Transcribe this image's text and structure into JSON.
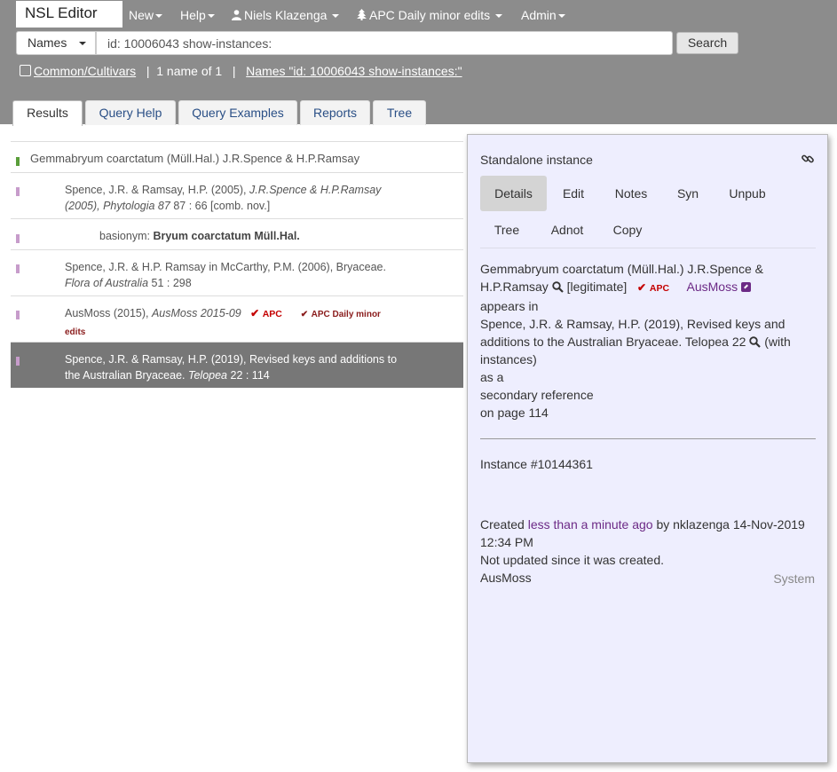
{
  "app": {
    "title": "NSL Editor"
  },
  "navbar": {
    "new_label": "New",
    "help_label": "Help",
    "user_label": "Niels Klazenga",
    "tree_label": "APC Daily minor edits",
    "admin_label": "Admin"
  },
  "search": {
    "scope_label": "Names",
    "query_value": "id: 10006043 show-instances:",
    "button_label": "Search"
  },
  "subbar": {
    "common_label": "Common/Cultivars",
    "count_text": "1 name of 1",
    "sep": "|",
    "query_link": "Names \"id: 10006043 show-instances:\""
  },
  "tabs": [
    "Results",
    "Query Help",
    "Query Examples",
    "Reports",
    "Tree"
  ],
  "results": {
    "name_row": "Gemmabryum coarctatum (Müll.Hal.) J.R.Spence & H.P.Ramsay",
    "r1": {
      "a": "Spence, J.R. & Ramsay, H.P. (2005), ",
      "b": "J.R.Spence & H.P.Ramsay",
      "c": "(2005), Phytologia 87",
      "d": " 87 : 66 [comb. nov.]"
    },
    "r2": {
      "label": "basionym: ",
      "name": "Bryum coarctatum Müll.Hal."
    },
    "r3": {
      "a": "Spence, J.R. & H.P. Ramsay in McCarthy, P.M. (2006), Bryaceae.",
      "b": "Flora of Australia",
      "c": " 51 : 298"
    },
    "r4": {
      "a": "AusMoss (2015), ",
      "b": "AusMoss 2015-09",
      "apc": "APC",
      "tree": "APC Daily minor",
      "tree2": "edits"
    },
    "r5": {
      "a": "Spence, J.R. & Ramsay, H.P. (2019), Revised keys and additions to",
      "b": "the Australian Bryaceae. ",
      "c": "Telopea",
      "d": " 22 : 114"
    }
  },
  "panel": {
    "title": "Standalone instance",
    "tabs": [
      "Details",
      "Edit",
      "Notes",
      "Syn",
      "Unpub",
      "Tree",
      "Adnot",
      "Copy"
    ],
    "name_line1": "Gemmabryum coarctatum (Müll.Hal.) J.R.Spence &",
    "name_line2": "H.P.Ramsay",
    "status": "[legitimate]",
    "apc": "APC",
    "ausmoss_link": "AusMoss",
    "appears_in": "appears in",
    "ref_line1": "Spence, J.R. & Ramsay, H.P. (2019), Revised keys and",
    "ref_line2a": "additions to the Australian Bryaceae. Telopea 22",
    "ref_line2b": "(with",
    "ref_line3": "instances)",
    "as_a": "as a",
    "ref_type": "secondary reference",
    "page": "on page 114",
    "instance_id": "Instance #10144361",
    "created_prefix": "Created ",
    "created_when": "less than a minute ago",
    "created_suffix": " by nklazenga 14-Nov-2019",
    "created_time": "12:34 PM",
    "not_updated": "Not updated since it was created.",
    "dataset": "AusMoss",
    "system": "System"
  },
  "colors": {
    "header_bg": "#8c8c8c",
    "panel_bg": "#eeeefe",
    "selected_row": "#777777",
    "accepted_bar": "#5a9e3a",
    "instance_bar": "#c79ccb",
    "apc_red": "#c40000",
    "link_purple": "#6c2a86"
  },
  "icons": [
    "user-icon",
    "tree-icon",
    "search-icon",
    "link-icon",
    "external-link-icon",
    "check-icon"
  ]
}
